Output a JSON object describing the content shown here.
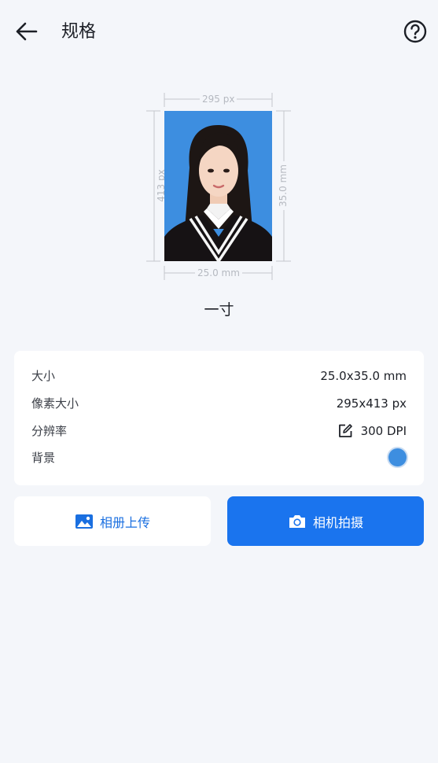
{
  "header": {
    "title": "规格",
    "back_icon": "arrow-left-icon",
    "help_icon": "question-circle-icon"
  },
  "preview": {
    "width_px_label": "295 px",
    "height_px_label": "413 px",
    "width_mm_label": "25.0 mm",
    "height_mm_label": "35.0 mm",
    "background_color": "#3d8ee0"
  },
  "spec_name": "一寸",
  "info": {
    "size_label": "大小",
    "size_value": "25.0x35.0 mm",
    "pixel_label": "像素大小",
    "pixel_value": "295x413 px",
    "resolution_label": "分辨率",
    "resolution_value": "300 DPI",
    "background_label": "背景",
    "background_color": "#3d8ee0"
  },
  "actions": {
    "album_label": "相册上传",
    "camera_label": "相机拍摄"
  },
  "colors": {
    "accent": "#1a74ee",
    "page_bg": "#f4f6fa"
  }
}
